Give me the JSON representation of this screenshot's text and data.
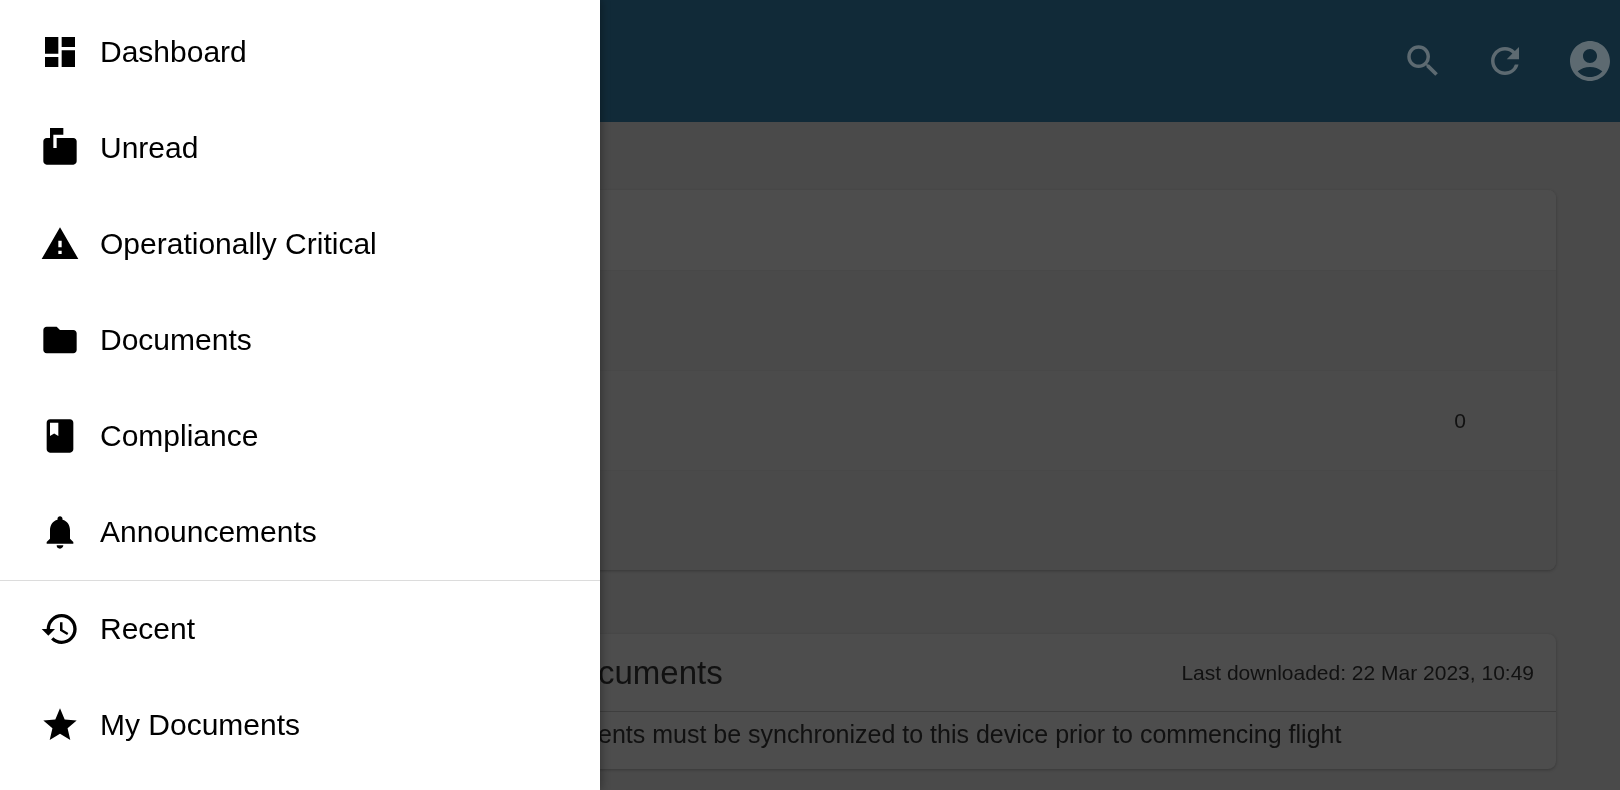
{
  "drawer": {
    "sections": [
      {
        "items": [
          {
            "label": "Dashboard"
          },
          {
            "label": "Unread"
          },
          {
            "label": "Operationally Critical"
          },
          {
            "label": "Documents"
          },
          {
            "label": "Compliance"
          },
          {
            "label": "Announcements"
          }
        ]
      },
      {
        "items": [
          {
            "label": "Recent"
          },
          {
            "label": "My Documents"
          }
        ]
      }
    ]
  },
  "summary_card": {
    "count": "0"
  },
  "documents_card": {
    "title": "cuments",
    "last_downloaded": "Last downloaded: 22 Mar 2023, 10:49",
    "message": "ents must be synchronized to this device prior to commencing flight"
  }
}
